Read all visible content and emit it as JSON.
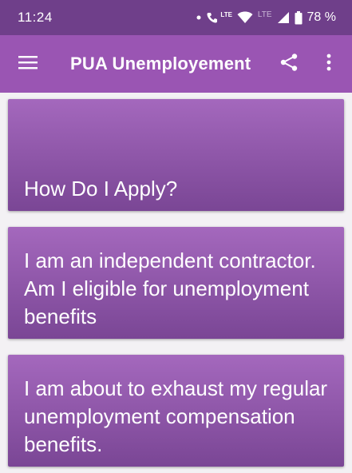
{
  "status_bar": {
    "time": "11:24",
    "network_label": "LTE",
    "network_label_2": "LTE",
    "battery": "78 %"
  },
  "app_bar": {
    "title": "PUA Unemployement",
    "menu_icon": "hamburger-menu-icon",
    "share_icon": "share-icon",
    "more_icon": "more-vert-icon"
  },
  "cards": [
    {
      "label": "How Do I Apply?"
    },
    {
      "label": "I am an independent contractor. Am I eligible for unemployment benefits"
    },
    {
      "label": "I am about to exhaust my regular unemployment compensation benefits."
    }
  ],
  "colors": {
    "status_bar": "#6f3f8a",
    "app_bar": "#9a55b3",
    "card_top": "#a468bd",
    "card_bottom": "#7a4695",
    "background": "#f3f1f4"
  }
}
